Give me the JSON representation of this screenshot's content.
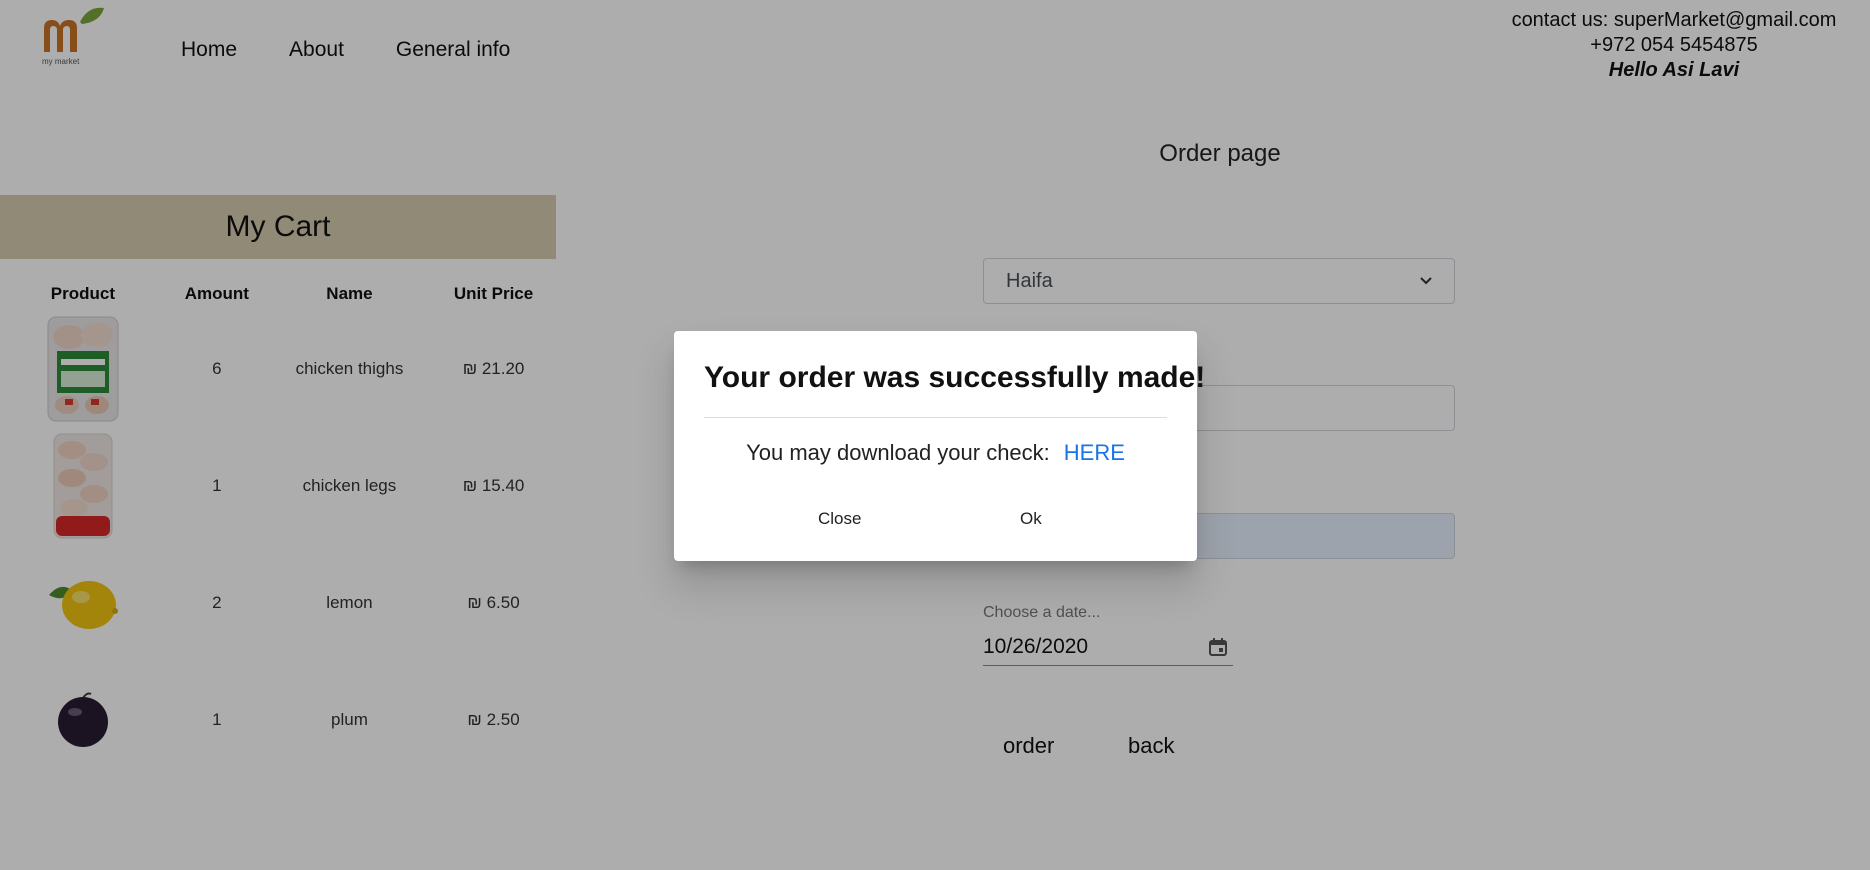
{
  "header": {
    "logo_text": "my market",
    "nav": [
      "Home",
      "About",
      "General info"
    ],
    "contact_line": "contact us: superMarket@gmail.com",
    "phone": "+972 054 5454875",
    "greeting": "Hello Asi Lavi"
  },
  "cart": {
    "title": "My Cart",
    "columns": [
      "Product",
      "Amount",
      "Name",
      "Unit Price"
    ],
    "rows": [
      {
        "product_icon": "chicken-thighs-package-icon",
        "amount": "6",
        "name": "chicken thighs",
        "price": "₪ 21.20"
      },
      {
        "product_icon": "chicken-legs-package-icon",
        "amount": "1",
        "name": "chicken legs",
        "price": "₪ 15.40"
      },
      {
        "product_icon": "lemon-icon",
        "amount": "2",
        "name": "lemon",
        "price": "₪ 6.50"
      },
      {
        "product_icon": "plum-icon",
        "amount": "1",
        "name": "plum",
        "price": "₪ 2.50"
      }
    ]
  },
  "order": {
    "title": "Order page",
    "city_value": "Haifa",
    "date_label": "Choose a date...",
    "date_value": "10/26/2020",
    "order_label": "order",
    "back_label": "back"
  },
  "modal": {
    "title": "Your order was successfully made!",
    "body_text": "You may download your check:",
    "link_text": "HERE",
    "close_label": "Close",
    "ok_label": "Ok"
  },
  "colors": {
    "cart_header_bg": "#d6ccb0",
    "link": "#1a73e8",
    "logo_orange": "#c8742a",
    "logo_leaf": "#7aa53a"
  }
}
